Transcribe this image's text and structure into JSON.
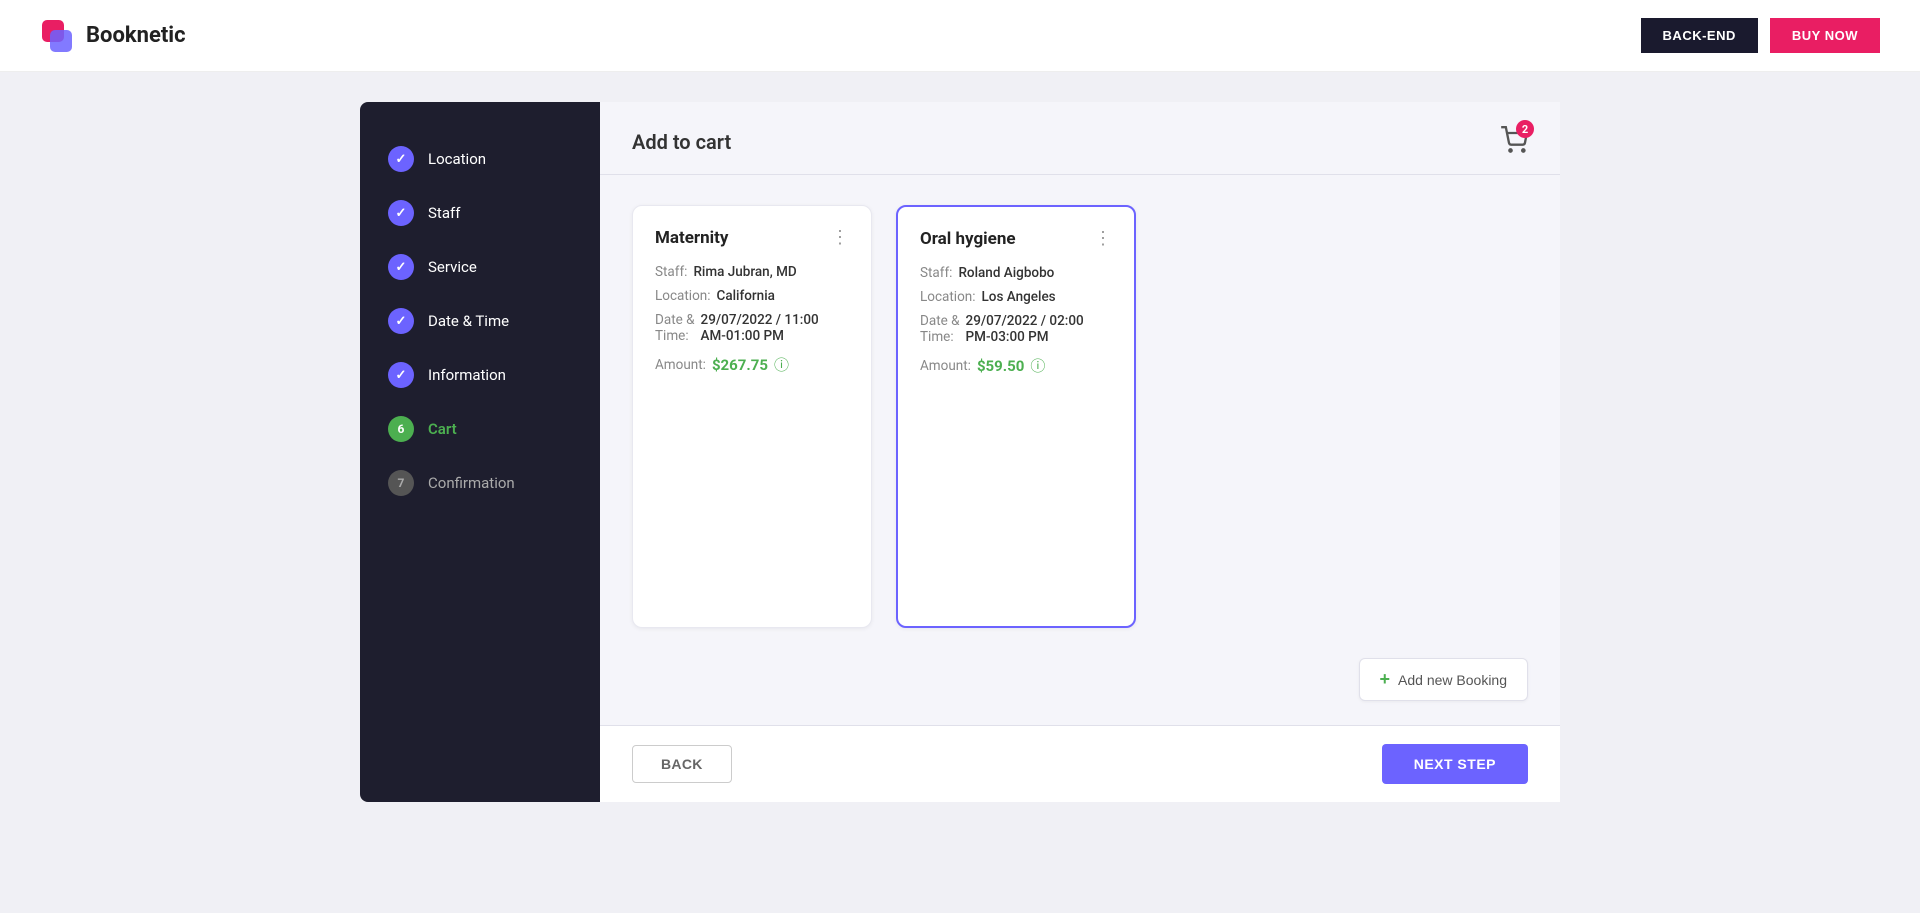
{
  "header": {
    "logo_text": "Booknetic",
    "btn_backend": "BACK-END",
    "btn_buynow": "BUY NOW"
  },
  "sidebar": {
    "items": [
      {
        "id": "location",
        "label": "Location",
        "step": "check",
        "state": "completed"
      },
      {
        "id": "staff",
        "label": "Staff",
        "step": "check",
        "state": "completed"
      },
      {
        "id": "service",
        "label": "Service",
        "step": "check",
        "state": "completed"
      },
      {
        "id": "datetime",
        "label": "Date & Time",
        "step": "check",
        "state": "completed"
      },
      {
        "id": "information",
        "label": "Information",
        "step": "check",
        "state": "completed"
      },
      {
        "id": "cart",
        "label": "Cart",
        "step": "6",
        "state": "current"
      },
      {
        "id": "confirmation",
        "label": "Confirmation",
        "step": "7",
        "state": "pending"
      }
    ]
  },
  "content": {
    "title": "Add to cart",
    "cart_count": "2"
  },
  "bookings": [
    {
      "id": "maternity",
      "title": "Maternity",
      "staff_label": "Staff:",
      "staff_value": "Rima Jubran, MD",
      "location_label": "Location:",
      "location_value": "California",
      "datetime_label": "Date &\nTime:",
      "datetime_value": "29/07/2022 / 11:00 AM-01:00 PM",
      "amount_label": "Amount:",
      "amount_value": "$267.75",
      "selected": false
    },
    {
      "id": "oral-hygiene",
      "title": "Oral hygiene",
      "staff_label": "Staff:",
      "staff_value": "Roland Aigbobo",
      "location_label": "Location:",
      "location_value": "Los Angeles",
      "datetime_label": "Date &\nTime:",
      "datetime_value": "29/07/2022 / 02:00 PM-03:00 PM",
      "amount_label": "Amount:",
      "amount_value": "$59.50",
      "selected": true
    }
  ],
  "add_booking": {
    "label": "Add new Booking"
  },
  "footer": {
    "back_label": "BACK",
    "next_label": "NEXT STEP"
  }
}
